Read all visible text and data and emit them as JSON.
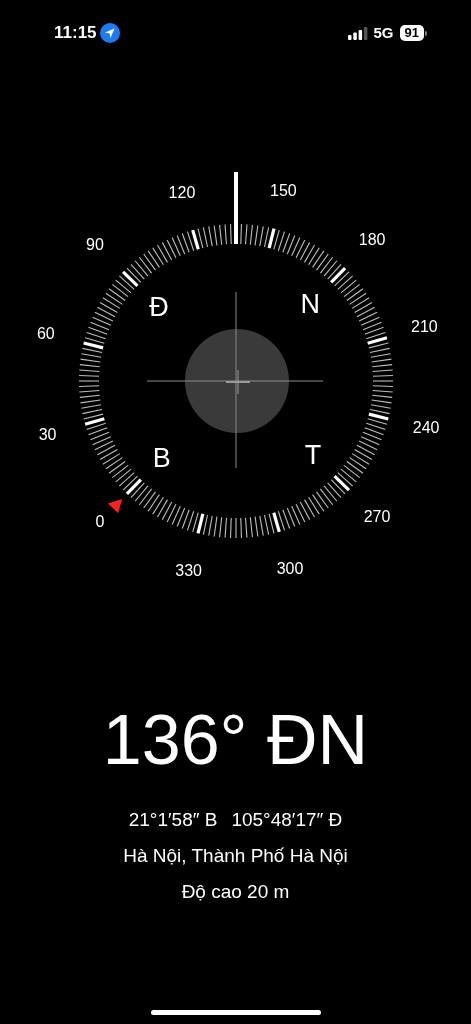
{
  "status_bar": {
    "time": "11:15",
    "network": "5G",
    "battery": "91"
  },
  "compass": {
    "degree_labels": [
      "0",
      "30",
      "60",
      "90",
      "120",
      "150",
      "180",
      "210",
      "240",
      "270",
      "300",
      "330"
    ],
    "cardinal_labels": [
      "Đ",
      "N",
      "B",
      "T"
    ]
  },
  "heading": "136° ĐN",
  "coordinates": [
    "21°1′58″ B",
    "105°48′17″ Đ"
  ],
  "place": "Hà Nội, Thành Phố Hà Nội",
  "altitude": "Độ cao 20 m"
}
